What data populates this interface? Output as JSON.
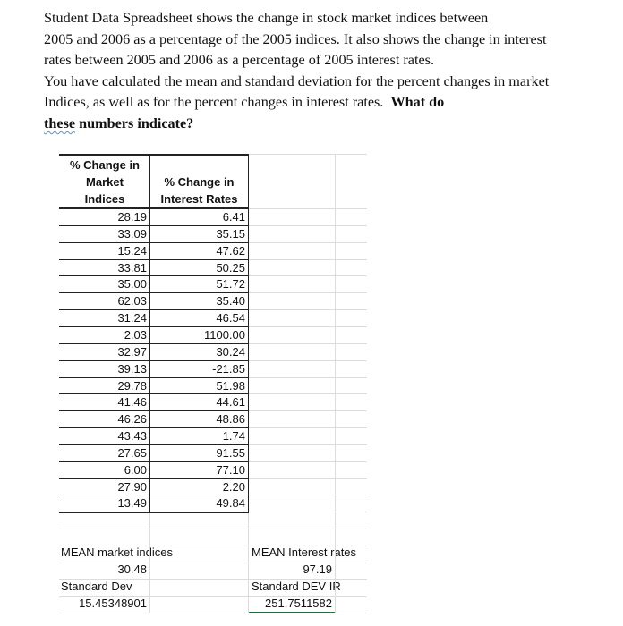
{
  "prompt": {
    "lines": [
      "Student Data Spreadsheet shows the change in stock  market indices between",
      "2005 and 2006 as a percentage of the 2005 indices.  It also shows the change in interest",
      "rates between 2005 and 2006 as a percentage of 2005 interest rates.",
      "You have calculated the mean and standard deviation for the percent changes in market"
    ],
    "line5_plain": "Indices, as well as for the percent changes in interest rates.  ",
    "line5_bold": "What do",
    "line6_bold_underlined": "these",
    "line6_bold": " numbers indicate?"
  },
  "table": {
    "headers": {
      "market": [
        "% Change in",
        "Market",
        "Indices"
      ],
      "interest": [
        "% Change in",
        "Interest Rates"
      ]
    },
    "rows": [
      {
        "market": "28.19",
        "interest": "6.41"
      },
      {
        "market": "33.09",
        "interest": "35.15"
      },
      {
        "market": "15.24",
        "interest": "47.62"
      },
      {
        "market": "33.81",
        "interest": "50.25"
      },
      {
        "market": "35.00",
        "interest": "51.72"
      },
      {
        "market": "62.03",
        "interest": "35.40"
      },
      {
        "market": "31.24",
        "interest": "46.54"
      },
      {
        "market": "2.03",
        "interest": "1100.00"
      },
      {
        "market": "32.97",
        "interest": "30.24"
      },
      {
        "market": "39.13",
        "interest": "-21.85"
      },
      {
        "market": "29.78",
        "interest": "51.98"
      },
      {
        "market": "41.46",
        "interest": "44.61"
      },
      {
        "market": "46.26",
        "interest": "48.86"
      },
      {
        "market": "43.43",
        "interest": "1.74"
      },
      {
        "market": "27.65",
        "interest": "91.55"
      },
      {
        "market": "6.00",
        "interest": "77.10"
      },
      {
        "market": "27.90",
        "interest": "2.20"
      },
      {
        "market": "13.49",
        "interest": "49.84"
      }
    ]
  },
  "summary": {
    "mean_market_label": "MEAN market indices",
    "mean_market_value": "30.48",
    "std_market_label": "Standard Dev",
    "std_market_value": "15.45348901",
    "mean_interest_label": "MEAN Interest rates",
    "mean_interest_value": "97.19",
    "std_interest_label": "Standard DEV IR",
    "std_interest_value": "251.7511582"
  },
  "colors": {
    "selected_cell_accent": "#1e7145",
    "spellcheck_squiggle": "#5b8fd6"
  }
}
